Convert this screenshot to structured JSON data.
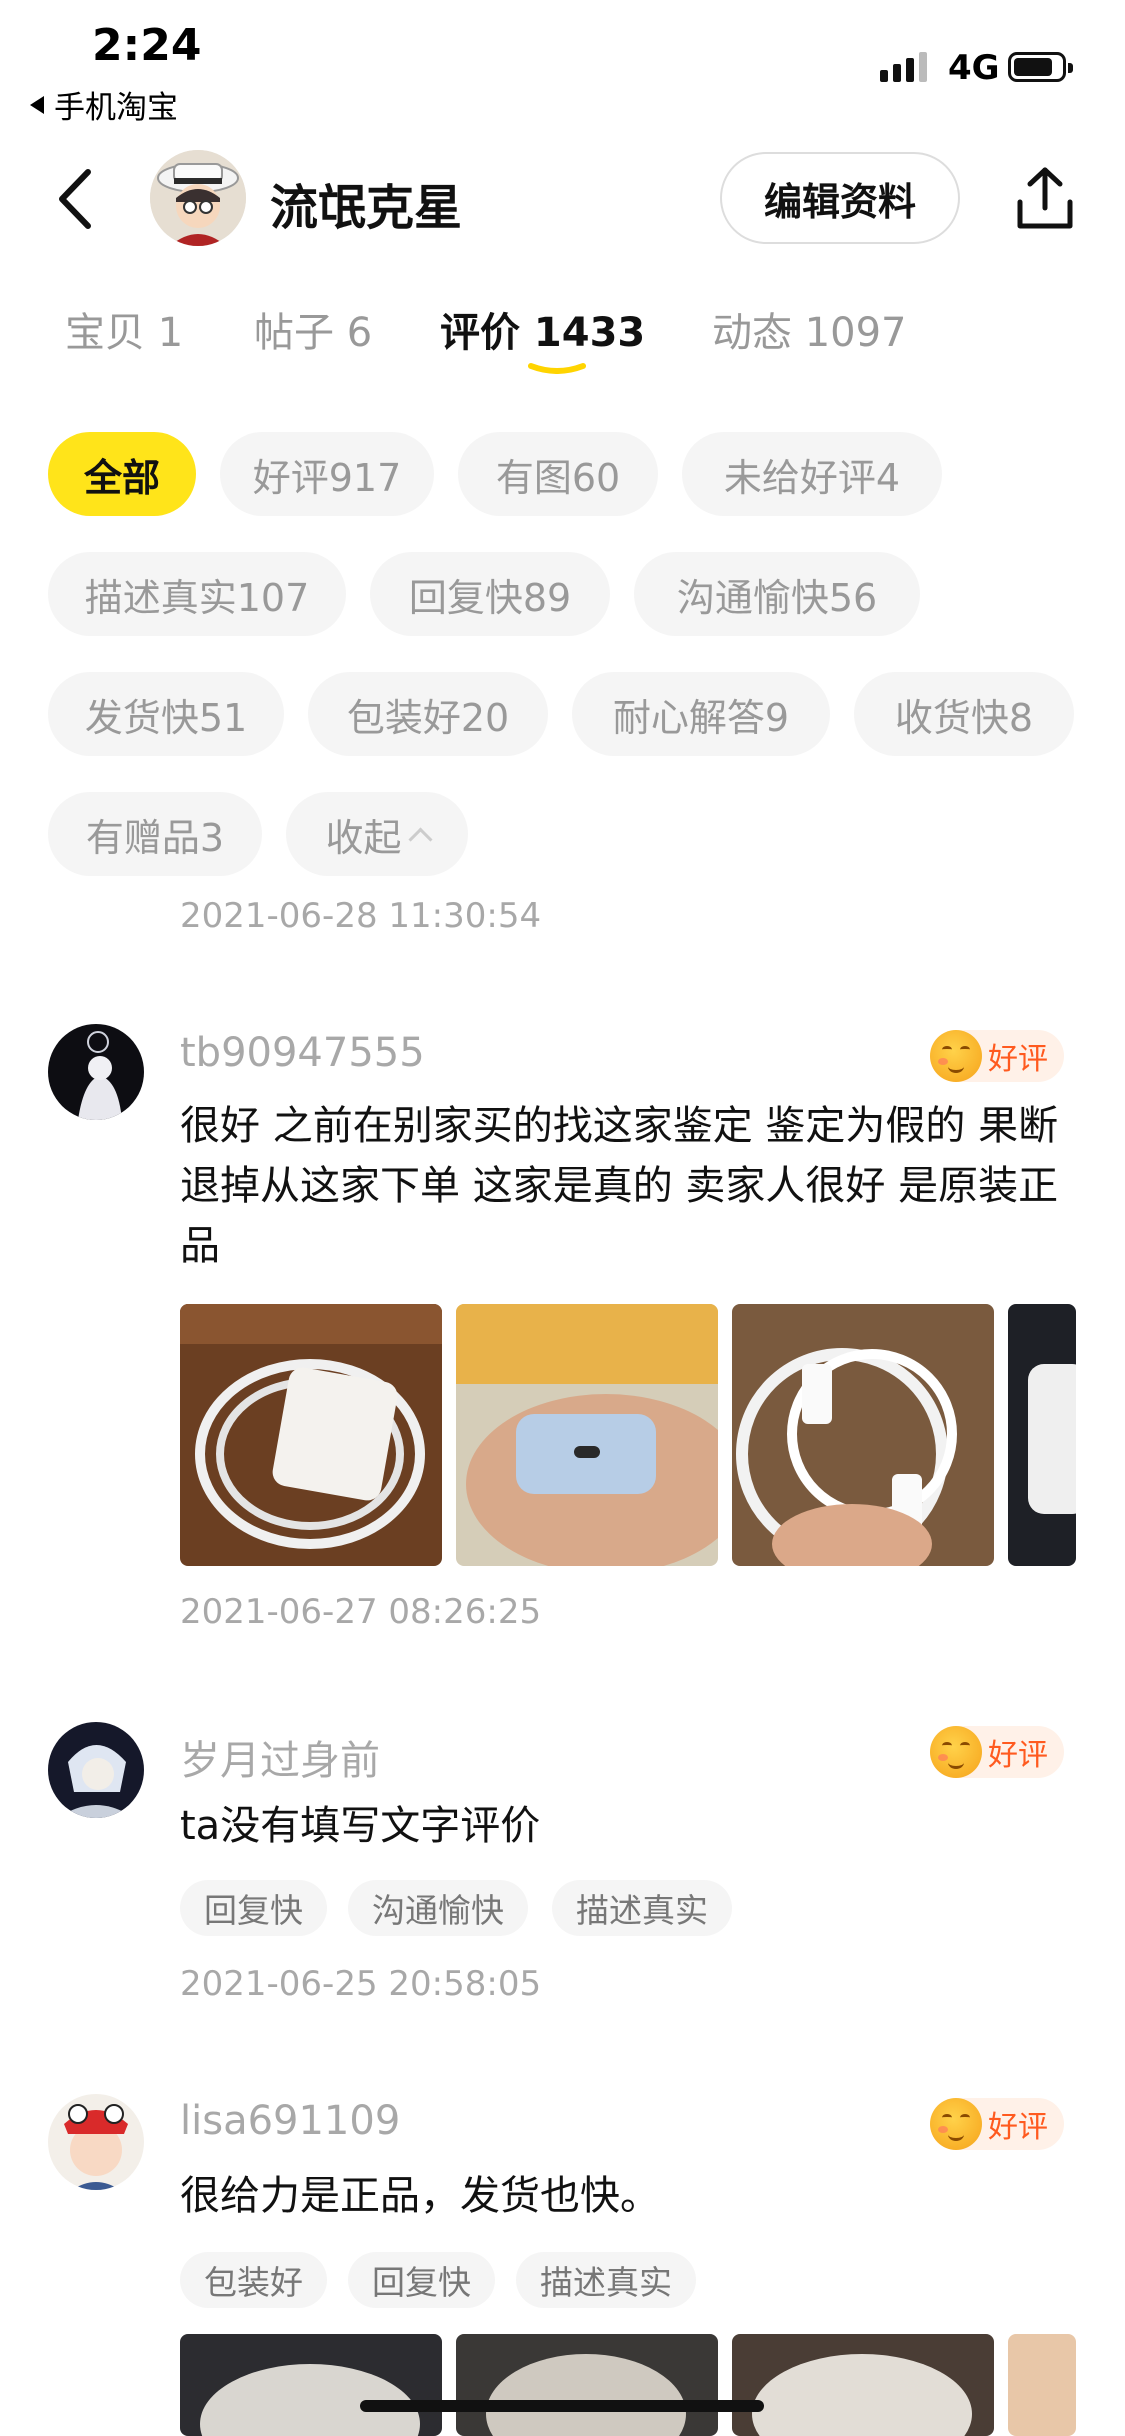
{
  "status": {
    "time": "2:24",
    "back_app": "手机淘宝",
    "network": "4G"
  },
  "header": {
    "name": "流氓克星",
    "edit_label": "编辑资料"
  },
  "tabs": [
    {
      "label": "宝贝 1"
    },
    {
      "label": "帖子 6"
    },
    {
      "label": "评价 1433",
      "active": true
    },
    {
      "label": "动态 1097"
    }
  ],
  "filters": [
    {
      "label": "全部",
      "active": true
    },
    {
      "label": "好评917"
    },
    {
      "label": "有图60"
    },
    {
      "label": "未给好评4"
    },
    {
      "label": "描述真实107"
    },
    {
      "label": "回复快89"
    },
    {
      "label": "沟通愉快56"
    },
    {
      "label": "发货快51"
    },
    {
      "label": "包装好20"
    },
    {
      "label": "耐心解答9"
    },
    {
      "label": "收货快8"
    },
    {
      "label": "有赠品3"
    },
    {
      "label": "收起"
    }
  ],
  "top_timestamp": "2021-06-28 11:30:54",
  "reviews": [
    {
      "user": "tb90947555",
      "rating": "好评",
      "text": "很好 之前在别家买的找这家鉴定 鉴定为假的 果断退掉从这家下单 这家是真的 卖家人很好 是原装正品",
      "tags": [],
      "timestamp": "2021-06-27 08:26:25"
    },
    {
      "user": "岁月过身前",
      "rating": "好评",
      "text": "ta没有填写文字评价",
      "tags": [
        "回复快",
        "沟通愉快",
        "描述真实"
      ],
      "timestamp": "2021-06-25 20:58:05"
    },
    {
      "user": "lisa691109",
      "rating": "好评",
      "text": "很给力是正品，发货也快。",
      "tags": [
        "包装好",
        "回复快",
        "描述真实"
      ]
    }
  ],
  "colors": {
    "accent_yellow": "#ffe41a",
    "badge_text": "#ff5a1f",
    "muted": "#a8a8a8"
  }
}
